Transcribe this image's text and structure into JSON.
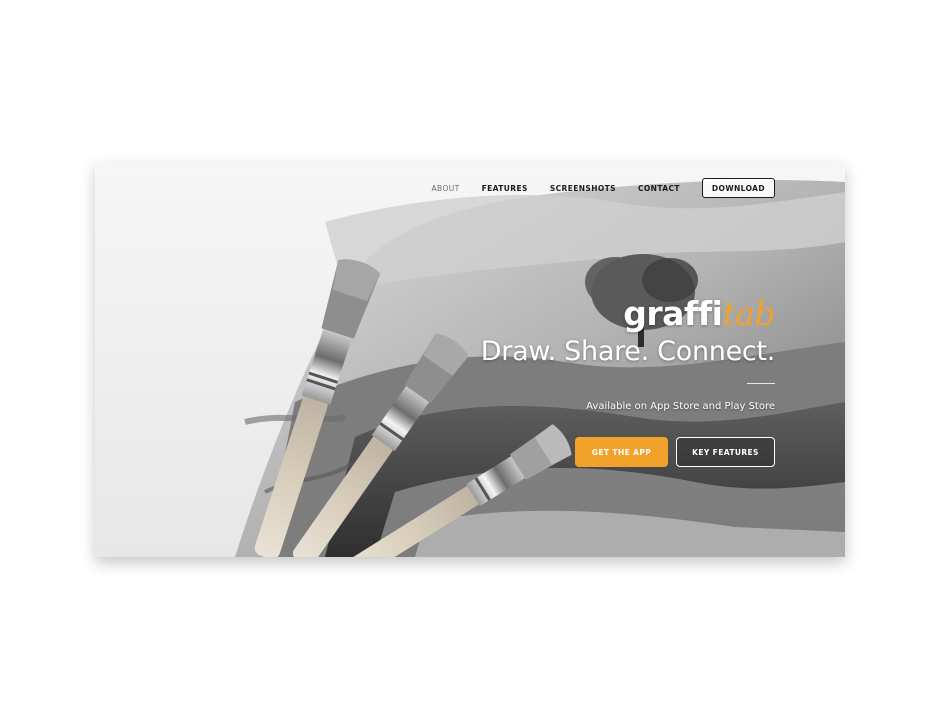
{
  "nav": {
    "items": [
      {
        "label": "ABOUT",
        "active": true
      },
      {
        "label": "FEATURES",
        "active": false
      },
      {
        "label": "SCREENSHOTS",
        "active": false
      },
      {
        "label": "CONTACT",
        "active": false
      }
    ],
    "download_label": "DOWNLOAD"
  },
  "hero": {
    "brand_primary": "graffi",
    "brand_accent": "tab",
    "tagline": "Draw. Share. Connect.",
    "subline": "Available on App Store and Play Store",
    "primary_cta": "GET THE APP",
    "secondary_cta": "KEY FEATURES"
  },
  "colors": {
    "accent": "#f0a22a",
    "nav_text": "#1b1b1b",
    "nav_active": "#6f6f6f",
    "hero_text": "#ffffff"
  },
  "icons": {
    "background_art": "paintbrushes-landscape-painting"
  }
}
